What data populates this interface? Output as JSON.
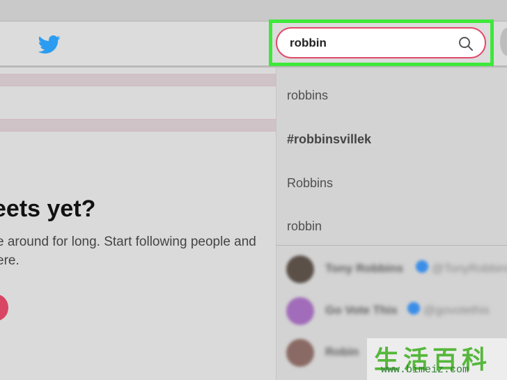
{
  "search": {
    "value": "robbin"
  },
  "left_panel": {
    "heading": "eets yet?",
    "line1": "e around for long. Start following people and",
    "line2": "ere."
  },
  "dropdown": {
    "suggestions": [
      {
        "label": "robbins"
      },
      {
        "label": "#robbinsvillek"
      },
      {
        "label": "Robbins"
      },
      {
        "label": "robbin"
      }
    ],
    "users": [
      {
        "name": "Tony Robbins",
        "handle": "@TonyRobbins"
      },
      {
        "name": "Go Vote This",
        "handle": "@govotethis"
      },
      {
        "name": "Robin"
      }
    ]
  },
  "watermark": {
    "main": "生活百科",
    "url": "www.bimeiz.com"
  }
}
